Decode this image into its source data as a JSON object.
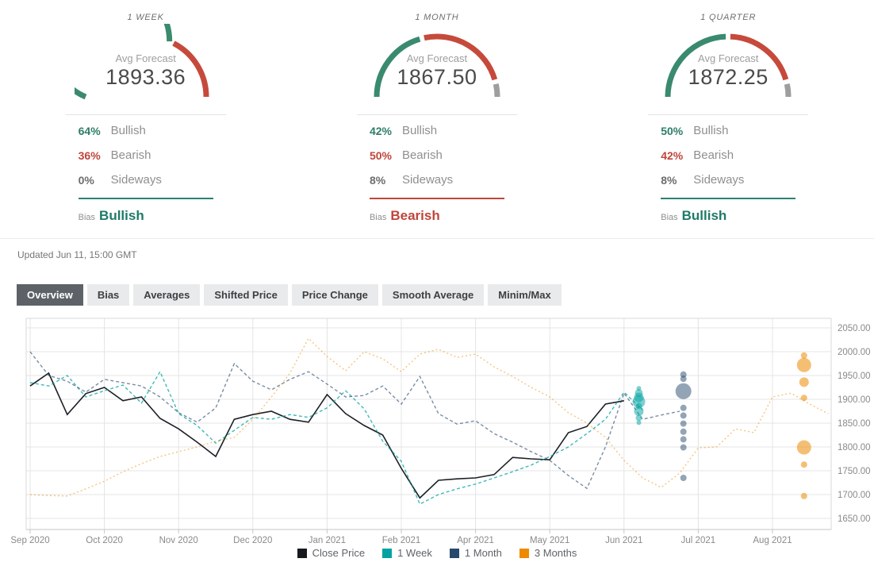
{
  "gauges": [
    {
      "title": "1 WEEK",
      "avg_label": "Avg Forecast",
      "avg_forecast": "1893.36",
      "bullish": 64,
      "bearish": 36,
      "sideways": 0,
      "bullish_pct": "64%",
      "bearish_pct": "36%",
      "sideways_pct": "0%",
      "bullish_label": "Bullish",
      "bearish_label": "Bearish",
      "sideways_label": "Sideways",
      "bias_label": "Bias",
      "bias": "Bullish",
      "bias_color": "#1e7a68",
      "accent_color": "#2a8273"
    },
    {
      "title": "1 MONTH",
      "avg_label": "Avg Forecast",
      "avg_forecast": "1867.50",
      "bullish": 42,
      "bearish": 50,
      "sideways": 8,
      "bullish_pct": "42%",
      "bearish_pct": "50%",
      "sideways_pct": "8%",
      "bullish_label": "Bullish",
      "bearish_label": "Bearish",
      "sideways_label": "Sideways",
      "bias_label": "Bias",
      "bias": "Bearish",
      "bias_color": "#c0453a",
      "accent_color": "#c0453a"
    },
    {
      "title": "1 QUARTER",
      "avg_label": "Avg Forecast",
      "avg_forecast": "1872.25",
      "bullish": 50,
      "bearish": 42,
      "sideways": 8,
      "bullish_pct": "50%",
      "bearish_pct": "42%",
      "sideways_pct": "8%",
      "bullish_label": "Bullish",
      "bearish_label": "Bearish",
      "sideways_label": "Sideways",
      "bias_label": "Bias",
      "bias": "Bullish",
      "bias_color": "#1e7a68",
      "accent_color": "#2a8273"
    }
  ],
  "updated_text": "Updated Jun 11, 15:00 GMT",
  "tabs": [
    {
      "label": "Overview",
      "active": true
    },
    {
      "label": "Bias",
      "active": false
    },
    {
      "label": "Averages",
      "active": false
    },
    {
      "label": "Shifted Price",
      "active": false
    },
    {
      "label": "Price Change",
      "active": false
    },
    {
      "label": "Smooth Average",
      "active": false
    },
    {
      "label": "Minim/Max",
      "active": false
    }
  ],
  "colors": {
    "gauge_green": "#3a8a6e",
    "gauge_red": "#c64a3c",
    "gauge_gray": "#9e9e9e",
    "bullish_text": "#2e7d68",
    "bearish_text": "#c0453a",
    "sideways_text": "#6d6d6d",
    "grid": "#e4e4e4",
    "plot_border": "#d8d8d8",
    "axis": "#c6c6c6",
    "tick_label": "#8a8a8a"
  },
  "chart_data": {
    "type": "line",
    "title": "",
    "y_axis": {
      "min": 1650,
      "max": 2050,
      "grid": true,
      "position": "right",
      "ticks": [
        {
          "value": 2050,
          "label": "2050.00"
        },
        {
          "value": 2000,
          "label": "2000.00"
        },
        {
          "value": 1950,
          "label": "1950.00"
        },
        {
          "value": 1900,
          "label": "1900.00"
        },
        {
          "value": 1850,
          "label": "1850.00"
        },
        {
          "value": 1800,
          "label": "1800.00"
        },
        {
          "value": 1750,
          "label": "1750.00"
        },
        {
          "value": 1700,
          "label": "1700.00"
        },
        {
          "value": 1650,
          "label": "1650.00"
        }
      ]
    },
    "x_axis": {
      "unit": "week",
      "ticks": [
        {
          "label": "Sep 2020",
          "week": 0
        },
        {
          "label": "Oct 2020",
          "week": 4
        },
        {
          "label": "Nov 2020",
          "week": 8
        },
        {
          "label": "Dec 2020",
          "week": 12
        },
        {
          "label": "Jan 2021",
          "week": 16
        },
        {
          "label": "Feb 2021",
          "week": 20
        },
        {
          "label": "Apr 2021",
          "week": 24
        },
        {
          "label": "May 2021",
          "week": 28
        },
        {
          "label": "Jun 2021",
          "week": 32
        },
        {
          "label": "Jul 2021",
          "week": 36
        },
        {
          "label": "Aug 2021",
          "week": 40
        }
      ]
    },
    "series": [
      {
        "name": "Close Price",
        "color": "#1c2025",
        "style": "solid",
        "dash": "",
        "opacity": 1,
        "width": 1.6,
        "values": [
          1928,
          1955,
          1868,
          1912,
          1925,
          1897,
          1905,
          1860,
          1838,
          1810,
          1780,
          1858,
          1868,
          1875,
          1858,
          1852,
          1910,
          1870,
          1845,
          1825,
          1755,
          1693,
          1730,
          1733,
          1735,
          1742,
          1778,
          1775,
          1773,
          1830,
          1843,
          1890,
          1897
        ]
      },
      {
        "name": "1 Week",
        "color": "#00a2a2",
        "style": "dashed",
        "dash": "4 3",
        "opacity": 0.75,
        "width": 1.4,
        "values": [
          1935,
          1928,
          1950,
          1905,
          1918,
          1930,
          1892,
          1958,
          1870,
          1845,
          1808,
          1835,
          1862,
          1858,
          1868,
          1862,
          1882,
          1918,
          1880,
          1812,
          1770,
          1680,
          1700,
          1712,
          1722,
          1735,
          1748,
          1762,
          1780,
          1800,
          1828,
          1858,
          1915,
          1878
        ]
      },
      {
        "name": "1 Month",
        "color": "#27496d",
        "style": "dashed",
        "dash": "4 3",
        "opacity": 0.62,
        "width": 1.4,
        "values": [
          2000,
          1950,
          1938,
          1915,
          1942,
          1935,
          1928,
          1905,
          1872,
          1852,
          1882,
          1975,
          1938,
          1920,
          1942,
          1958,
          1932,
          1905,
          1908,
          1928,
          1890,
          1948,
          1870,
          1848,
          1855,
          1828,
          1810,
          1790,
          1772,
          1740,
          1713,
          1800,
          1913,
          1858,
          1867,
          1875
        ]
      },
      {
        "name": "3 Months",
        "color": "#ed8b00",
        "style": "dotted",
        "dash": "2 3",
        "opacity": 0.5,
        "width": 1.4,
        "values": [
          1700,
          1698,
          1697,
          1712,
          1728,
          1748,
          1765,
          1780,
          1790,
          1800,
          1812,
          1820,
          1858,
          1905,
          1955,
          2028,
          1990,
          1960,
          2000,
          1985,
          1958,
          1995,
          2005,
          1988,
          1995,
          1968,
          1948,
          1925,
          1905,
          1872,
          1850,
          1820,
          1772,
          1735,
          1715,
          1745,
          1798,
          1800,
          1838,
          1830,
          1905,
          1913,
          1890,
          1870
        ]
      }
    ],
    "forecast_dots": [
      {
        "series": "1 Week",
        "color": "#00a2a2",
        "x_week": 32.8,
        "opacity": 0.5,
        "points": [
          {
            "value": 1923,
            "size": 3
          },
          {
            "value": 1913,
            "size": 5
          },
          {
            "value": 1904,
            "size": 6
          },
          {
            "value": 1895,
            "size": 8
          },
          {
            "value": 1886,
            "size": 4
          },
          {
            "value": 1875,
            "size": 6
          },
          {
            "value": 1861,
            "size": 4
          },
          {
            "value": 1851,
            "size": 3
          }
        ]
      },
      {
        "series": "1 Month",
        "color": "#27496d",
        "x_week": 35.2,
        "opacity": 0.5,
        "points": [
          {
            "value": 1952,
            "size": 4
          },
          {
            "value": 1943,
            "size": 4
          },
          {
            "value": 1917,
            "size": 10
          },
          {
            "value": 1882,
            "size": 4
          },
          {
            "value": 1866,
            "size": 4
          },
          {
            "value": 1849,
            "size": 4
          },
          {
            "value": 1832,
            "size": 4
          },
          {
            "value": 1816,
            "size": 4
          },
          {
            "value": 1799,
            "size": 4
          },
          {
            "value": 1735,
            "size": 4
          }
        ]
      },
      {
        "series": "3 Months",
        "color": "#ed8b00",
        "x_week": 41.7,
        "opacity": 0.55,
        "points": [
          {
            "value": 1992,
            "size": 4
          },
          {
            "value": 1972,
            "size": 9
          },
          {
            "value": 1936,
            "size": 6
          },
          {
            "value": 1903,
            "size": 4
          },
          {
            "value": 1799,
            "size": 9
          },
          {
            "value": 1763,
            "size": 4
          },
          {
            "value": 1697,
            "size": 4
          }
        ]
      }
    ],
    "legend": [
      {
        "label": "Close Price",
        "color": "#16191d"
      },
      {
        "label": "1 Week",
        "color": "#00a2a2"
      },
      {
        "label": "1 Month",
        "color": "#27496d"
      },
      {
        "label": "3 Months",
        "color": "#ed8b00"
      }
    ],
    "legend_position": "bottom"
  }
}
